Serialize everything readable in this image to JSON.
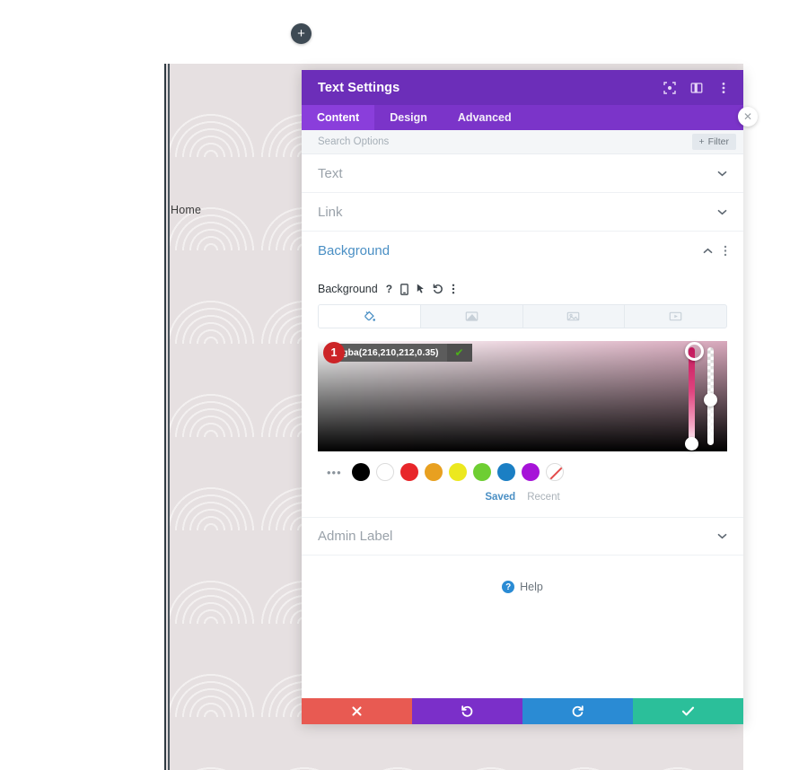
{
  "canvas": {
    "home_label": "Home",
    "add_button_label": "+",
    "pattern_color": "#e6e0e1"
  },
  "modal": {
    "title": "Text Settings",
    "header_icons": [
      {
        "name": "focus-icon"
      },
      {
        "name": "layout-panel-icon"
      },
      {
        "name": "more-vertical-icon"
      }
    ],
    "tabs": [
      {
        "label": "Content",
        "active": true
      },
      {
        "label": "Design",
        "active": false
      },
      {
        "label": "Advanced",
        "active": false
      }
    ],
    "search": {
      "placeholder": "Search Options",
      "value": "",
      "filter_label": "Filter",
      "filter_plus": "+"
    },
    "sections": [
      {
        "label": "Text",
        "open": false,
        "chevron": "⌄"
      },
      {
        "label": "Link",
        "open": false,
        "chevron": "⌄"
      },
      {
        "label": "Background",
        "open": true,
        "chevron": "⌃"
      },
      {
        "label": "Admin Label",
        "open": false,
        "chevron": "⌄"
      }
    ],
    "background": {
      "field_label": "Background",
      "field_icons": [
        {
          "name": "help-question-icon",
          "glyph": "?"
        },
        {
          "name": "responsive-device-icon",
          "glyph": "⎕"
        },
        {
          "name": "hover-cursor-icon",
          "glyph": "➤"
        },
        {
          "name": "reset-icon",
          "glyph": "↺"
        },
        {
          "name": "more-vertical-icon",
          "glyph": "⋮"
        }
      ],
      "type_tabs": [
        {
          "name": "background-color-tab",
          "active": true
        },
        {
          "name": "background-gradient-tab",
          "active": false
        },
        {
          "name": "background-image-tab",
          "active": false
        },
        {
          "name": "background-video-tab",
          "active": false
        }
      ],
      "color_value": "rgba(216,210,212,0.35)",
      "confirm_glyph": "✔",
      "step_badge": "1",
      "swatch_more": "•••",
      "swatches": [
        {
          "name": "swatch-black",
          "color": "#000000"
        },
        {
          "name": "swatch-white",
          "color": "#ffffff"
        },
        {
          "name": "swatch-red",
          "color": "#e8262a"
        },
        {
          "name": "swatch-orange",
          "color": "#e8a020"
        },
        {
          "name": "swatch-yellow",
          "color": "#ece81f"
        },
        {
          "name": "swatch-green",
          "color": "#6ece32"
        },
        {
          "name": "swatch-blue",
          "color": "#1b7fc4"
        },
        {
          "name": "swatch-purple",
          "color": "#a613d8"
        },
        {
          "name": "swatch-transparent",
          "color": "none"
        }
      ],
      "saved_label": "Saved",
      "recent_label": "Recent"
    },
    "help": {
      "label": "Help",
      "badge": "?"
    },
    "footer_buttons": [
      {
        "name": "cancel-button",
        "glyph": "✖",
        "color": "#e85a52"
      },
      {
        "name": "undo-button",
        "glyph": "↺",
        "color": "#7b2fc9"
      },
      {
        "name": "redo-button",
        "glyph": "↻",
        "color": "#2a8bd4"
      },
      {
        "name": "save-button",
        "glyph": "✔",
        "color": "#2bbf9a"
      }
    ]
  },
  "edge_close": {
    "glyph": "✕"
  }
}
